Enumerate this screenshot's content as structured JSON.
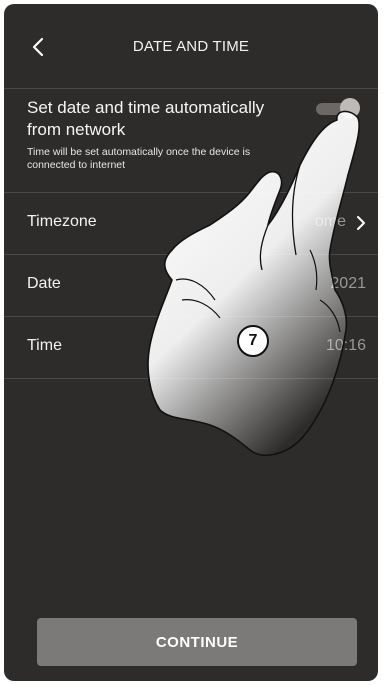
{
  "header": {
    "title": "DATE AND TIME",
    "back_icon": "chevron-left-icon"
  },
  "auto_time": {
    "title": "Set date and time automatically from network",
    "note": "Time will be set automatically once the device is connected to internet",
    "enabled": true
  },
  "rows": [
    {
      "label": "Timezone",
      "value": "ome",
      "has_chevron": true
    },
    {
      "label": "Date",
      "value": "2021",
      "has_chevron": false
    },
    {
      "label": "Time",
      "value": "10:16",
      "has_chevron": false
    }
  ],
  "continue_label": "CONTINUE",
  "step_badge": "7",
  "colors": {
    "background": "#2e2c2b",
    "divider": "#4a4746",
    "button": "#7c7a79",
    "toggle_track": "#6b6866",
    "toggle_knob": "#bdbab8"
  }
}
